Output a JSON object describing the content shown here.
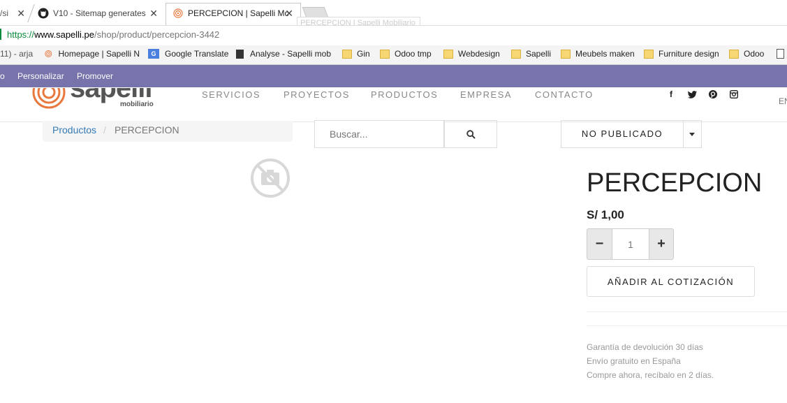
{
  "browser": {
    "tabs": [
      {
        "title": "/si"
      },
      {
        "title": "V10 - Sitemap generates"
      },
      {
        "title": "PERCEPCION | Sapelli Mc"
      }
    ],
    "ghost_tab": "PERCEPCION | Sapelli Mobiliario",
    "url_scheme": "https://",
    "url_host": "www.sapelli.pe",
    "url_path": "/shop/product/percepcion-3442",
    "bookmarks": [
      "11) - arja",
      "Homepage | Sapelli N",
      "Google Translate",
      "Analyse - Sapelli mob",
      "Gin",
      "Odoo tmp",
      "Webdesign",
      "Sapelli",
      "Meubels maken",
      "Furniture design",
      "Odoo"
    ]
  },
  "editbar": {
    "items": [
      "o",
      "Personalizar",
      "Promover"
    ]
  },
  "site": {
    "logo_text": "sapelli",
    "logo_sub": "mobiliario",
    "nav": [
      "SERVICIOS",
      "PROYECTOS",
      "PRODUCTOS",
      "EMPRESA",
      "CONTACTO"
    ],
    "lang": "EN"
  },
  "breadcrumb": {
    "parent": "Productos",
    "sep": "/",
    "current": "PERCEPCION"
  },
  "search": {
    "placeholder": "Buscar..."
  },
  "publish": {
    "label": "NO PUBLICADO"
  },
  "product": {
    "name": "PERCEPCION",
    "price": "S/ 1,00",
    "qty": "1",
    "minus": "−",
    "plus": "+",
    "add_label": "AÑADIR AL COTIZACIÓN",
    "info": [
      "Garantía de devolución 30 días",
      "Envío gratuito en España",
      "Compre ahora, recíbalo en 2 días."
    ]
  },
  "colors": {
    "editbar": "#7773ab",
    "logo": "#e8783d",
    "link": "#337ab7"
  }
}
